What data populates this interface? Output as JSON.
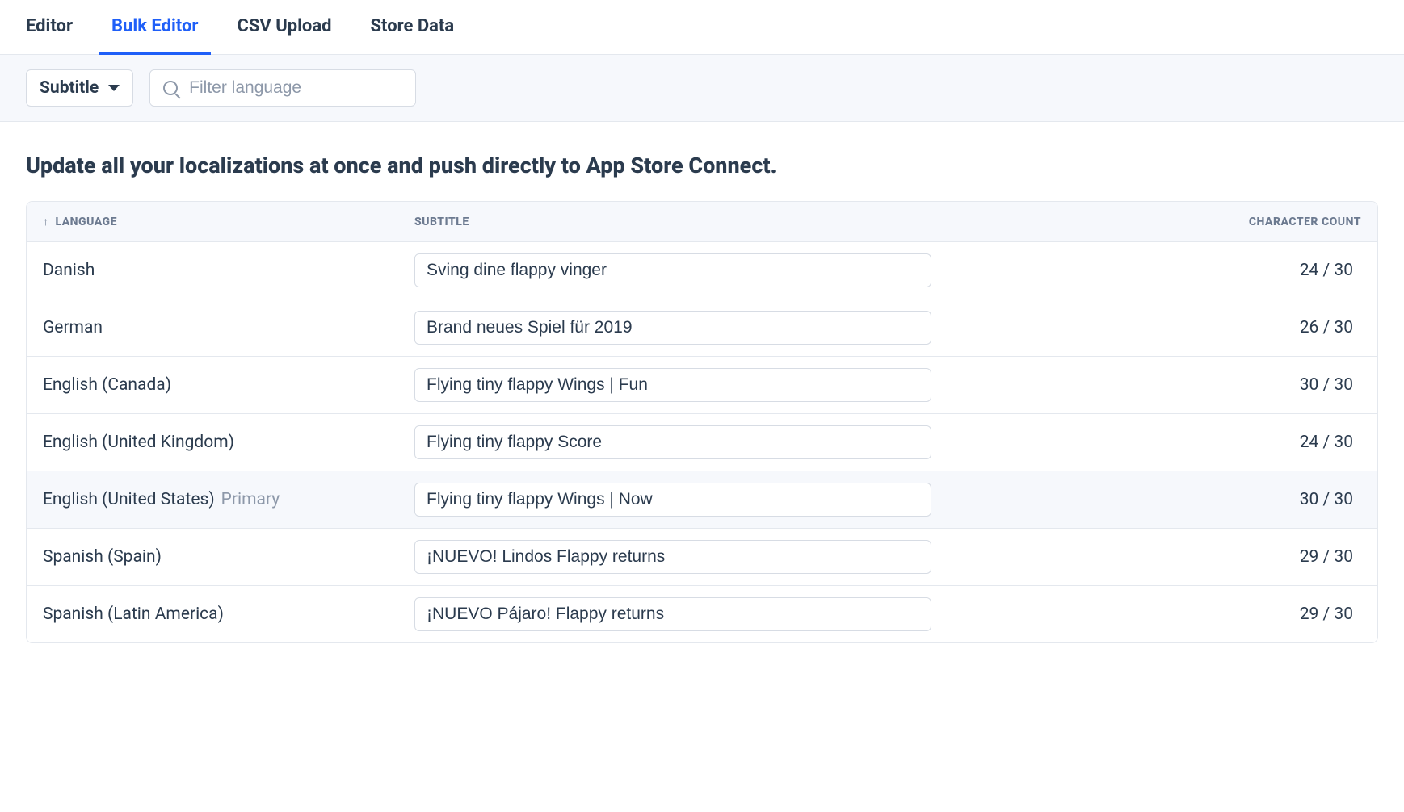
{
  "tabs": [
    {
      "label": "Editor",
      "active": false
    },
    {
      "label": "Bulk Editor",
      "active": true
    },
    {
      "label": "CSV Upload",
      "active": false
    },
    {
      "label": "Store Data",
      "active": false
    }
  ],
  "toolbar": {
    "dropdown_label": "Subtitle",
    "filter_placeholder": "Filter language"
  },
  "headline": "Update all your localizations at once and push directly to App Store Connect.",
  "table": {
    "columns": {
      "language": "Language",
      "subtitle": "Subtitle",
      "count": "Character Count"
    },
    "max_chars": 30,
    "rows": [
      {
        "language": "Danish",
        "primary": false,
        "subtitle": "Sving dine flappy vinger",
        "count": "24 / 30"
      },
      {
        "language": "German",
        "primary": false,
        "subtitle": "Brand neues Spiel für 2019",
        "count": "26 / 30"
      },
      {
        "language": "English (Canada)",
        "primary": false,
        "subtitle": "Flying tiny flappy Wings | Fun",
        "count": "30 / 30"
      },
      {
        "language": "English (United Kingdom)",
        "primary": false,
        "subtitle": "Flying tiny flappy Score",
        "count": "24 / 30"
      },
      {
        "language": "English (United States)",
        "primary": true,
        "subtitle": "Flying tiny flappy Wings | Now",
        "count": "30 / 30"
      },
      {
        "language": "Spanish (Spain)",
        "primary": false,
        "subtitle": "¡NUEVO! Lindos Flappy returns",
        "count": "29 / 30"
      },
      {
        "language": "Spanish (Latin America)",
        "primary": false,
        "subtitle": "¡NUEVO Pájaro! Flappy returns",
        "count": "29 / 30"
      }
    ],
    "primary_label": "Primary"
  }
}
